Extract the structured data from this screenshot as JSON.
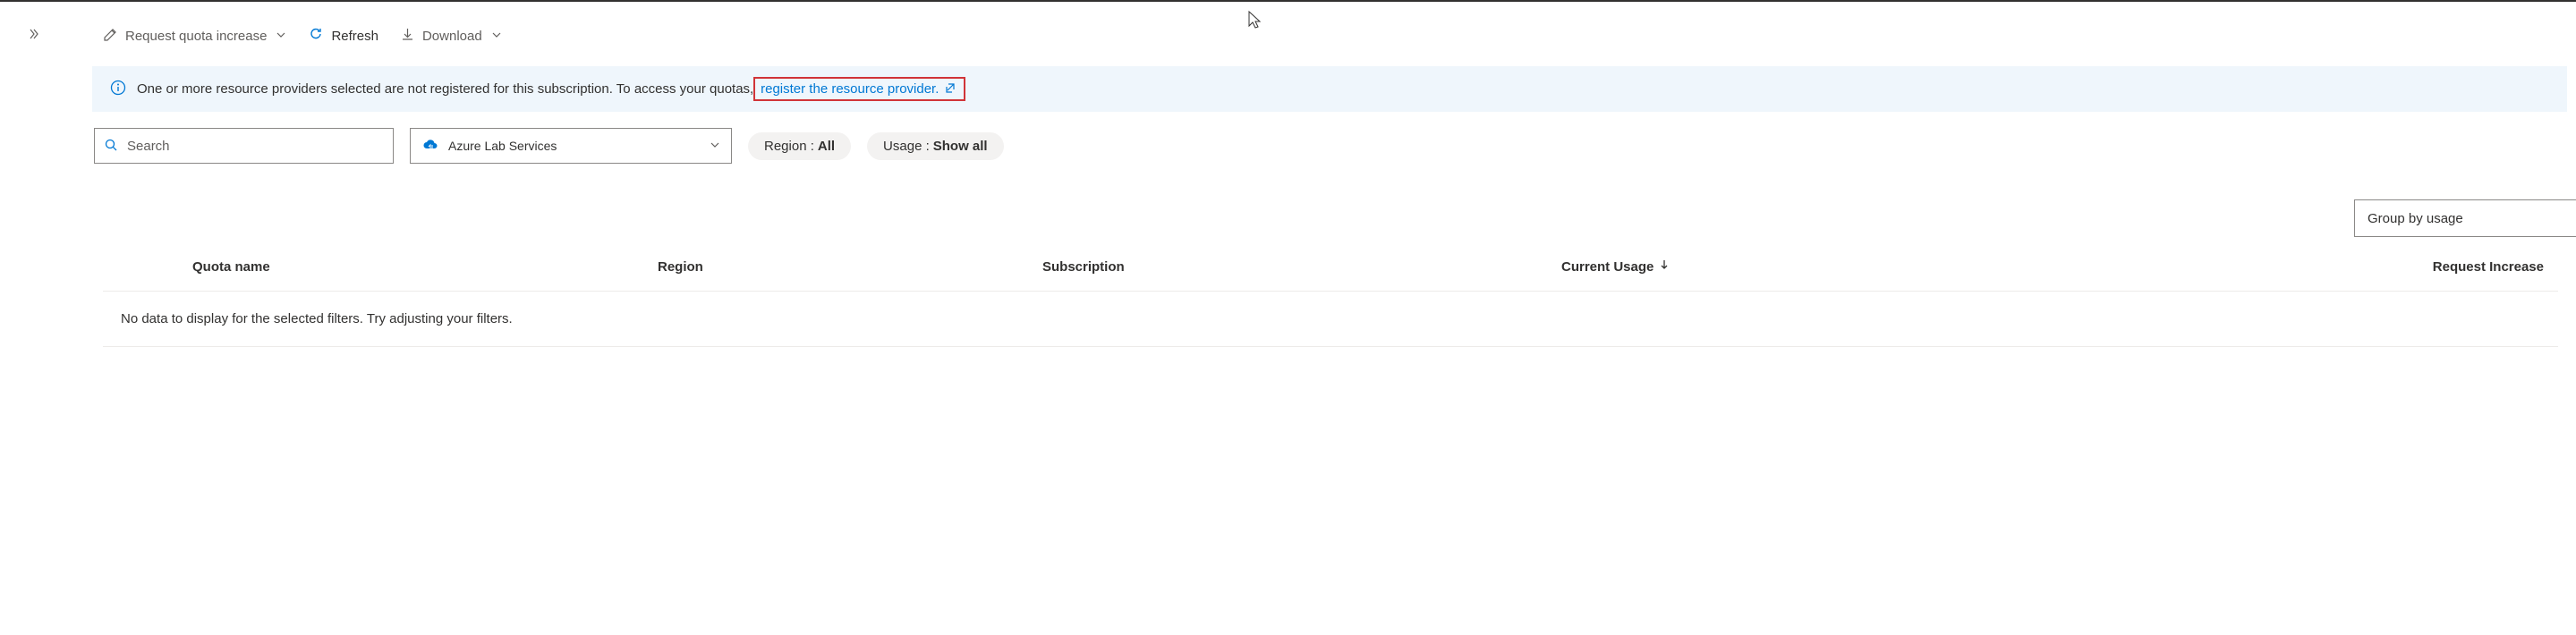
{
  "toolbar": {
    "request_quota_label": "Request quota increase",
    "refresh_label": "Refresh",
    "download_label": "Download"
  },
  "info": {
    "message": "One or more resource providers selected are not registered for this subscription. To access your quotas,",
    "link_text": "register the resource provider."
  },
  "filters": {
    "search_placeholder": "Search",
    "provider": "Azure Lab Services",
    "region_label": "Region :",
    "region_value": "All",
    "usage_label": "Usage :",
    "usage_value": "Show all"
  },
  "group_by": {
    "label": "Group by usage"
  },
  "table": {
    "headers": {
      "quota_name": "Quota name",
      "region": "Region",
      "subscription": "Subscription",
      "current_usage": "Current Usage",
      "request_increase": "Request Increase"
    },
    "empty_message": "No data to display for the selected filters. Try adjusting your filters."
  }
}
